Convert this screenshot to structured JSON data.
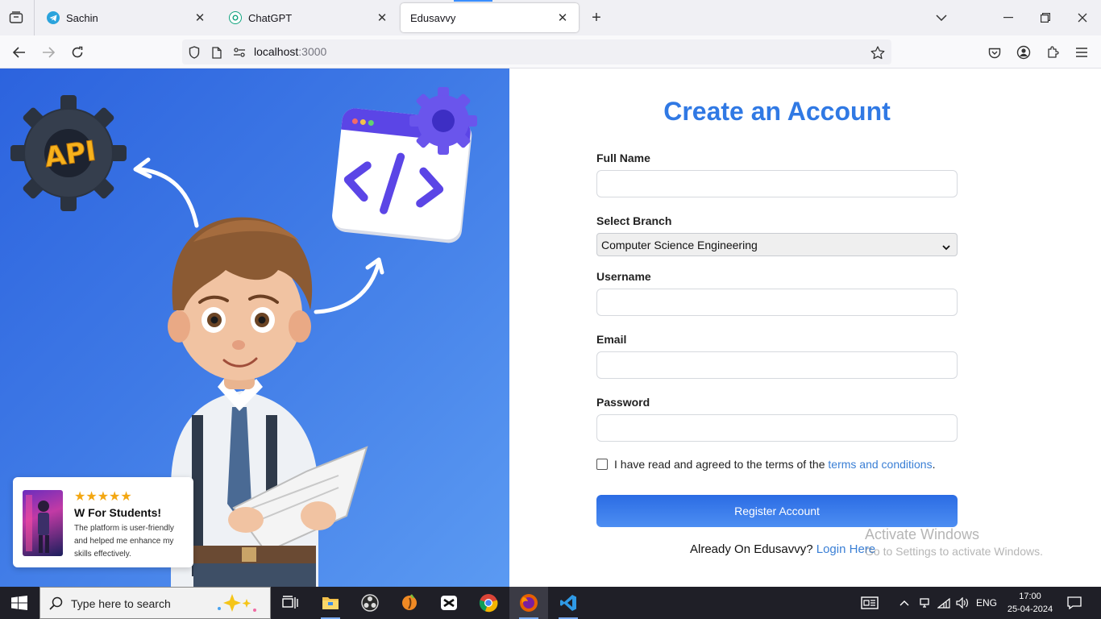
{
  "browser": {
    "tabs": [
      {
        "title": "Sachin",
        "icon": "telegram-icon"
      },
      {
        "title": "ChatGPT",
        "icon": "chatgpt-icon"
      },
      {
        "title": "Edusavvy",
        "icon": "none",
        "active": true
      }
    ],
    "url_host": "localhost",
    "url_port": ":3000"
  },
  "hero": {
    "badge_text": "API",
    "testimonial": {
      "stars": "★★★★★",
      "title": "W For Students!",
      "body": "The platform is user-friendly and helped me enhance my skills effectively."
    }
  },
  "form": {
    "title": "Create an Account",
    "full_name_label": "Full Name",
    "branch_label": "Select Branch",
    "branch_selected": "Computer Science Engineering",
    "username_label": "Username",
    "email_label": "Email",
    "password_label": "Password",
    "terms_prefix": "I have read and agreed to the terms of the ",
    "terms_link": "terms and conditions",
    "terms_suffix": ".",
    "register_label": "Register Account",
    "login_prompt": "Already On Edusavvy? ",
    "login_link": "Login Here"
  },
  "watermark": {
    "line1": "Activate Windows",
    "line2": "Go to Settings to activate Windows."
  },
  "taskbar": {
    "search_placeholder": "Type here to search",
    "language": "ENG",
    "time": "17:00",
    "date": "25-04-2024"
  },
  "colors": {
    "accent": "#3079e4",
    "link": "#3a7fd5",
    "hero_start": "#2c63de",
    "hero_end": "#5b9af2"
  }
}
